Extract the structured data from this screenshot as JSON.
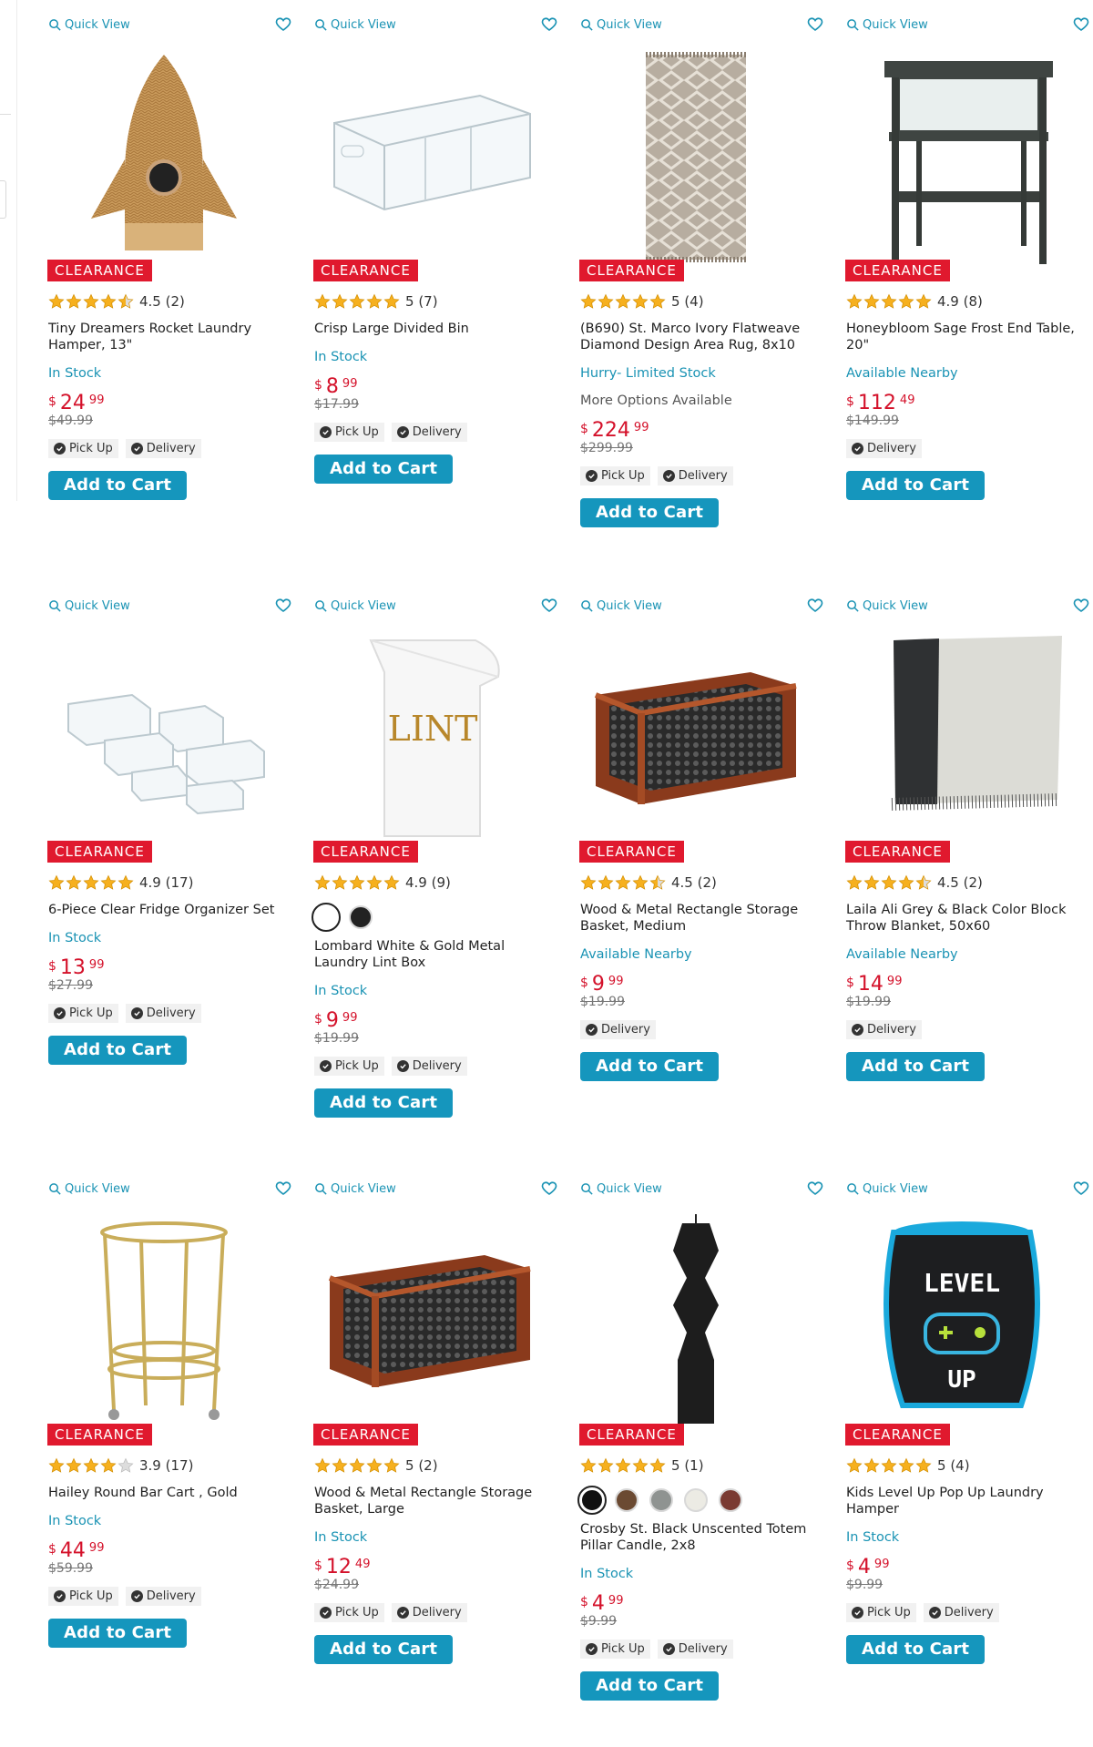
{
  "labels": {
    "quick_view": "Quick View",
    "clearance": "CLEARANCE",
    "add_to_cart": "Add to Cart",
    "pick_up": "Pick Up",
    "delivery": "Delivery",
    "currency": "$"
  },
  "colors": {
    "accent": "#1596bd",
    "sale": "#e0192e",
    "price": "#d4112a",
    "star": "#f6b01e"
  },
  "products": [
    {
      "title": "Tiny Dreamers Rocket Laundry Hamper, 13\"",
      "rating": "4.5",
      "stars": 4.5,
      "reviews": "(2)",
      "status": "In Stock",
      "price_dollars": "24",
      "price_cents": "99",
      "was": "$49.99",
      "pickup": true,
      "delivery": true,
      "image": "rocket-hamper"
    },
    {
      "title": "Crisp Large Divided Bin",
      "rating": "5",
      "stars": 5,
      "reviews": "(7)",
      "status": "In Stock",
      "price_dollars": "8",
      "price_cents": "99",
      "was": "$17.99",
      "pickup": true,
      "delivery": true,
      "image": "clear-bin"
    },
    {
      "title": "(B690) St. Marco Ivory Flatweave Diamond Design Area Rug, 8x10",
      "rating": "5",
      "stars": 5,
      "reviews": "(4)",
      "status": "Hurry- Limited Stock",
      "more": "More Options Available",
      "price_dollars": "224",
      "price_cents": "99",
      "was": "$299.99",
      "pickup": true,
      "delivery": true,
      "image": "rug"
    },
    {
      "title": "Honeybloom Sage Frost End Table, 20\"",
      "rating": "4.9",
      "stars": 5,
      "reviews": "(8)",
      "status": "Available Nearby",
      "price_dollars": "112",
      "price_cents": "49",
      "was": "$149.99",
      "pickup": false,
      "delivery": true,
      "image": "end-table"
    },
    {
      "title": "6-Piece Clear Fridge Organizer Set",
      "rating": "4.9",
      "stars": 5,
      "reviews": "(17)",
      "status": "In Stock",
      "price_dollars": "13",
      "price_cents": "99",
      "was": "$27.99",
      "pickup": true,
      "delivery": true,
      "image": "fridge-set"
    },
    {
      "title": "Lombard White & Gold Metal Laundry Lint Box",
      "rating": "4.9",
      "stars": 5,
      "reviews": "(9)",
      "status": "In Stock",
      "price_dollars": "9",
      "price_cents": "99",
      "was": "$19.99",
      "pickup": true,
      "delivery": true,
      "image": "lint-box",
      "swatches": [
        {
          "color": "#ffffff",
          "label": "LINT"
        },
        {
          "color": "#222222",
          "label": "LINT"
        }
      ],
      "lint_text": "LINT"
    },
    {
      "title": "Wood & Metal Rectangle Storage Basket, Medium",
      "rating": "4.5",
      "stars": 4.5,
      "reviews": "(2)",
      "status": "Available Nearby",
      "price_dollars": "9",
      "price_cents": "99",
      "was": "$19.99",
      "pickup": false,
      "delivery": true,
      "image": "wood-basket"
    },
    {
      "title": "Laila Ali Grey & Black Color Block Throw Blanket, 50x60",
      "rating": "4.5",
      "stars": 4.5,
      "reviews": "(2)",
      "status": "Available Nearby",
      "price_dollars": "14",
      "price_cents": "99",
      "was": "$19.99",
      "pickup": false,
      "delivery": true,
      "image": "throw-blanket"
    },
    {
      "title": "Hailey Round Bar Cart , Gold",
      "rating": "3.9",
      "stars": 4,
      "reviews": "(17)",
      "status": "In Stock",
      "price_dollars": "44",
      "price_cents": "99",
      "was": "$59.99",
      "pickup": true,
      "delivery": true,
      "image": "bar-cart"
    },
    {
      "title": "Wood & Metal Rectangle Storage Basket, Large",
      "rating": "5",
      "stars": 5,
      "reviews": "(2)",
      "status": "In Stock",
      "price_dollars": "12",
      "price_cents": "49",
      "was": "$24.99",
      "pickup": true,
      "delivery": true,
      "image": "wood-basket"
    },
    {
      "title": "Crosby St. Black Unscented Totem Pillar Candle, 2x8",
      "rating": "5",
      "stars": 5,
      "reviews": "(1)",
      "status": "In Stock",
      "price_dollars": "4",
      "price_cents": "99",
      "was": "$9.99",
      "pickup": true,
      "delivery": true,
      "image": "candle",
      "swatches": [
        {
          "color": "#111111"
        },
        {
          "color": "#6b4a32"
        },
        {
          "color": "#8f9391"
        },
        {
          "color": "#ecebe4"
        },
        {
          "color": "#7a3a32"
        }
      ]
    },
    {
      "title": "Kids Level Up Pop Up Laundry Hamper",
      "rating": "5",
      "stars": 5,
      "reviews": "(4)",
      "status": "In Stock",
      "price_dollars": "4",
      "price_cents": "99",
      "was": "$9.99",
      "pickup": true,
      "delivery": true,
      "image": "level-up-hamper",
      "hamper_text": [
        "LEVEL",
        "UP"
      ]
    }
  ]
}
